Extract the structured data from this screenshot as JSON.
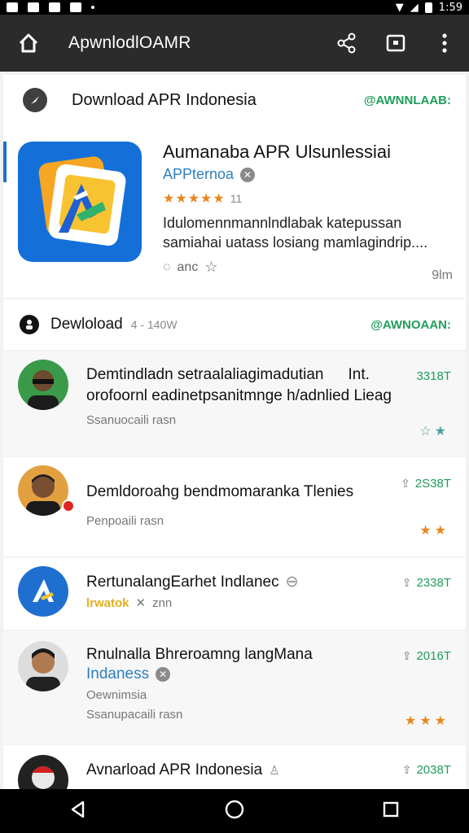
{
  "status_bar": {
    "time": "1:59"
  },
  "app_bar": {
    "title": "ApwnlodlOAMR"
  },
  "header": {
    "title": "Download APR Indonesia",
    "action": "@AWNNLAAB:"
  },
  "featured": {
    "name": "Aumanaba APR Ulsunlessiai",
    "developer": "APPternoa",
    "rating_stars": "★★★★★",
    "rating_count": "11",
    "description_line1": "Idulomennmannlndlabak katepussan",
    "description_line2": "samiahai uatass losiang mamlagindrip....",
    "meta": "anc",
    "time": "9lm"
  },
  "section2": {
    "title": "Dewloload",
    "sub": "4 - 140W",
    "action": "@AWNOAAN:"
  },
  "rows": [
    {
      "line1": "Demtindladn setraalaliagimadutian",
      "line1_extra": "Int.",
      "line2": "orofoornl eadinetpsanitmnge h/adnlied Lieag",
      "sub": "Ssanuocaili rasn",
      "count": "3318T",
      "stars": "☆★"
    },
    {
      "line1": "Demldoroahg bendmomaranka Tlenies",
      "sub": "Penpoaili rasn",
      "count": "2S38T",
      "stars": "★★"
    },
    {
      "line1": "RertunalangEarhet Indlanec",
      "tag": "lrwatok",
      "tag2": "znn",
      "count": "2338T"
    },
    {
      "line1": "Rnulnalla Bhreroamng langMana",
      "line2": "Indaness",
      "sub1": "Oewnimsia",
      "sub": "Ssanupacaili rasn",
      "count": "2016T",
      "stars": "★★★"
    },
    {
      "line1": "Avnarload APR Indonesia",
      "count": "2038T"
    }
  ]
}
